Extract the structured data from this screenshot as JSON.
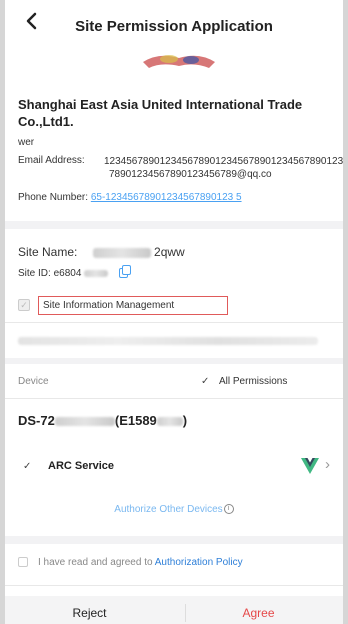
{
  "header": {
    "title": "Site Permission Application"
  },
  "applicant": {
    "company": "Shanghai East Asia United International Trade Co.,Ltd1.",
    "user": "wer",
    "email_label": "Email Address:",
    "email_line1": "12345678901234567890123456789012345678901234",
    "email_line2": "78901234567890123456789@qq.co",
    "phone_label": "Phone Number:",
    "phone_value": "65-12345678901234567890123 5"
  },
  "site": {
    "name_label": "Site Name:",
    "name_suffix": "2qww",
    "id_label": "Site ID: e6804",
    "permission_label": "Site Information Management"
  },
  "devices": {
    "device_label": "Device",
    "all_permissions_label": "All Permissions",
    "device_name_prefix": "DS-72",
    "device_name_mid": "(E1589",
    "device_name_suffix": ")",
    "service_label": "ARC Service",
    "authorize_other": "Authorize Other Devices"
  },
  "agreement": {
    "text": "I have read and agreed to ",
    "link": "Authorization Policy"
  },
  "footer": {
    "reject": "Reject",
    "agree": "Agree"
  },
  "colors": {
    "accent": "#4aa1f2",
    "agree": "#e54848",
    "highlight_border": "#e05a5a"
  }
}
